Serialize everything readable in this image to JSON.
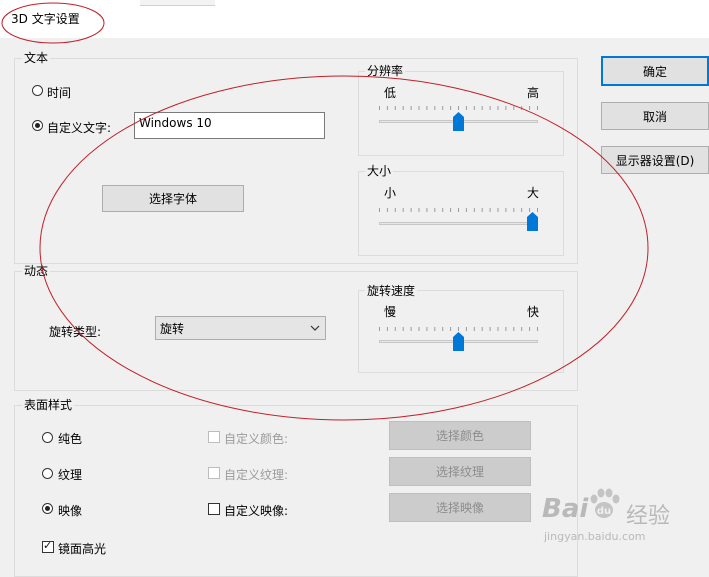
{
  "window": {
    "title": "3D 文字设置"
  },
  "text_group": {
    "label": "文本",
    "radio_time": "时间",
    "radio_custom": "自定义文字:",
    "custom_text_value": "Windows 10",
    "choose_font": "选择字体"
  },
  "resolution": {
    "label": "分辨率",
    "min_label": "低",
    "max_label": "高",
    "value_fraction": 0.5
  },
  "size": {
    "label": "大小",
    "min_label": "小",
    "max_label": "大",
    "value_fraction": 1.0
  },
  "motion_group": {
    "label": "动态",
    "rotation_type_label": "旋转类型:",
    "rotation_type_value": "旋转"
  },
  "rotation_speed": {
    "label": "旋转速度",
    "min_label": "慢",
    "max_label": "快",
    "value_fraction": 0.5
  },
  "surface_group": {
    "label": "表面样式",
    "solid": "纯色",
    "texture": "纹理",
    "reflection": "映像",
    "specular": "镜面高光",
    "custom_color": "自定义颜色:",
    "custom_texture": "自定义纹理:",
    "custom_reflection": "自定义映像:",
    "choose_color": "选择颜色",
    "choose_texture": "选择纹理",
    "choose_reflection": "选择映像"
  },
  "buttons": {
    "ok": "确定",
    "cancel": "取消",
    "display_settings": "显示器设置(D)"
  },
  "watermark": {
    "brand": "Bai",
    "brand2": "经验",
    "url": "jingyan.baidu.com"
  },
  "colors": {
    "accent": "#0078d7",
    "annotation": "#c0202a"
  }
}
